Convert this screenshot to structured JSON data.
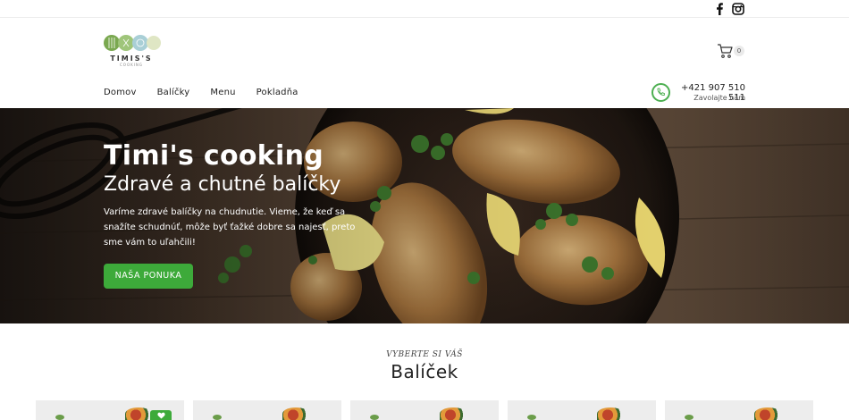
{
  "topbar": {
    "social": [
      {
        "name": "facebook-icon",
        "glyph": "f"
      },
      {
        "name": "instagram-icon",
        "glyph": ""
      }
    ]
  },
  "header": {
    "logo": {
      "text": "TIMIS'S",
      "subtext": "COOKING"
    },
    "cart": {
      "count": "0"
    },
    "nav": [
      {
        "label": "Domov"
      },
      {
        "label": "Balíčky"
      },
      {
        "label": "Menu"
      },
      {
        "label": "Pokladňa"
      }
    ],
    "contact": {
      "phone": "+421 907 510 511",
      "cta": "Zavolajte nám"
    }
  },
  "hero": {
    "title": "Timi's cooking",
    "subtitle": "Zdravé a chutné balíčky",
    "text": "Varíme zdravé balíčky na chudnutie. Vieme, že keď sa snažíte schudnúť, môže byť ťažké dobre sa najesť, preto sme vám to uľahčili!",
    "button": "NAŠA PONUKA"
  },
  "section": {
    "pretitle": "VYBERTE SI VÁŠ",
    "title": "Balíček"
  },
  "colors": {
    "accent": "#3daa3a",
    "text": "#222222"
  }
}
